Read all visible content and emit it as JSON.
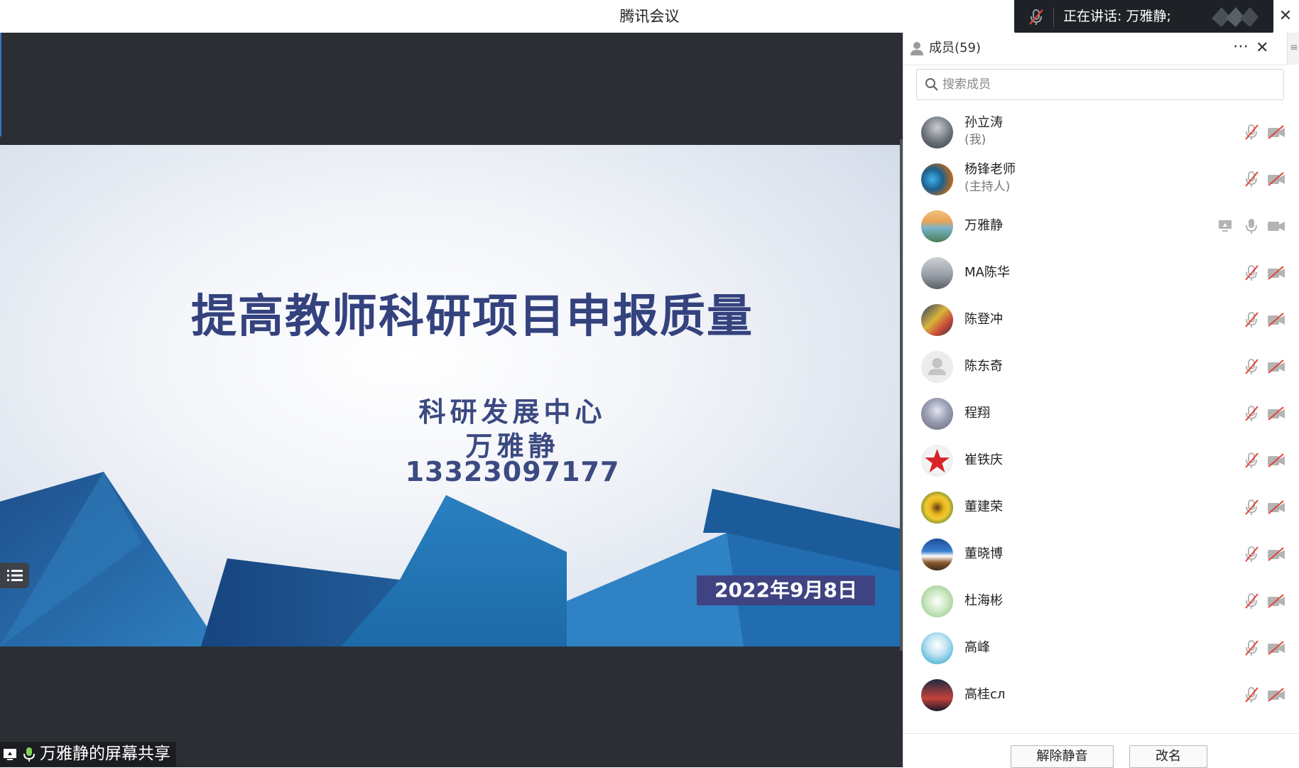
{
  "window": {
    "title": "腾讯会议",
    "close_symbol": "✕"
  },
  "speaking_banner": {
    "text": "正在讲话: 万雅静;"
  },
  "video": {
    "share_label": "万雅静的屏幕共享",
    "slide": {
      "title": "提高教师科研项目申报质量",
      "department": "科研发展中心",
      "presenter": "万雅静",
      "phone": "13323097177",
      "date": "2022年9月8日"
    }
  },
  "members_panel": {
    "title": "成员(59)",
    "more_symbol": "⋯",
    "close_symbol": "✕",
    "toggle_symbol": "≡",
    "search_placeholder": "搜索成员",
    "members": [
      {
        "name": "孙立涛",
        "role": "(我)",
        "mic": "muted",
        "cam": "off",
        "sharing": false
      },
      {
        "name": "杨锋老师",
        "role": "(主持人)",
        "mic": "muted",
        "cam": "off",
        "sharing": false
      },
      {
        "name": "万雅静",
        "role": "",
        "mic": "on",
        "cam": "off",
        "sharing": true
      },
      {
        "name": "MA陈华",
        "role": "",
        "mic": "muted",
        "cam": "off",
        "sharing": false
      },
      {
        "name": "陈登冲",
        "role": "",
        "mic": "muted",
        "cam": "off",
        "sharing": false
      },
      {
        "name": "陈东奇",
        "role": "",
        "mic": "muted",
        "cam": "off",
        "sharing": false
      },
      {
        "name": "程翔",
        "role": "",
        "mic": "muted",
        "cam": "off",
        "sharing": false
      },
      {
        "name": "崔铁庆",
        "role": "",
        "mic": "muted",
        "cam": "off",
        "sharing": false
      },
      {
        "name": "董建荣",
        "role": "",
        "mic": "muted",
        "cam": "off",
        "sharing": false
      },
      {
        "name": "董晓博",
        "role": "",
        "mic": "muted",
        "cam": "off",
        "sharing": false
      },
      {
        "name": "杜海彬",
        "role": "",
        "mic": "muted",
        "cam": "off",
        "sharing": false
      },
      {
        "name": "高峰",
        "role": "",
        "mic": "muted",
        "cam": "off",
        "sharing": false
      },
      {
        "name": "高桂сл",
        "role": "",
        "mic": "muted",
        "cam": "off",
        "sharing": false
      }
    ],
    "footer": {
      "unmute_label": "解除静音",
      "rename_label": "改名"
    }
  },
  "colors": {
    "video_bg": "#2b2f34",
    "slide_title": "#34427e",
    "date_badge": "#3f4381",
    "muted_red": "#e0443c",
    "icon_gray": "#b4b4b4"
  }
}
